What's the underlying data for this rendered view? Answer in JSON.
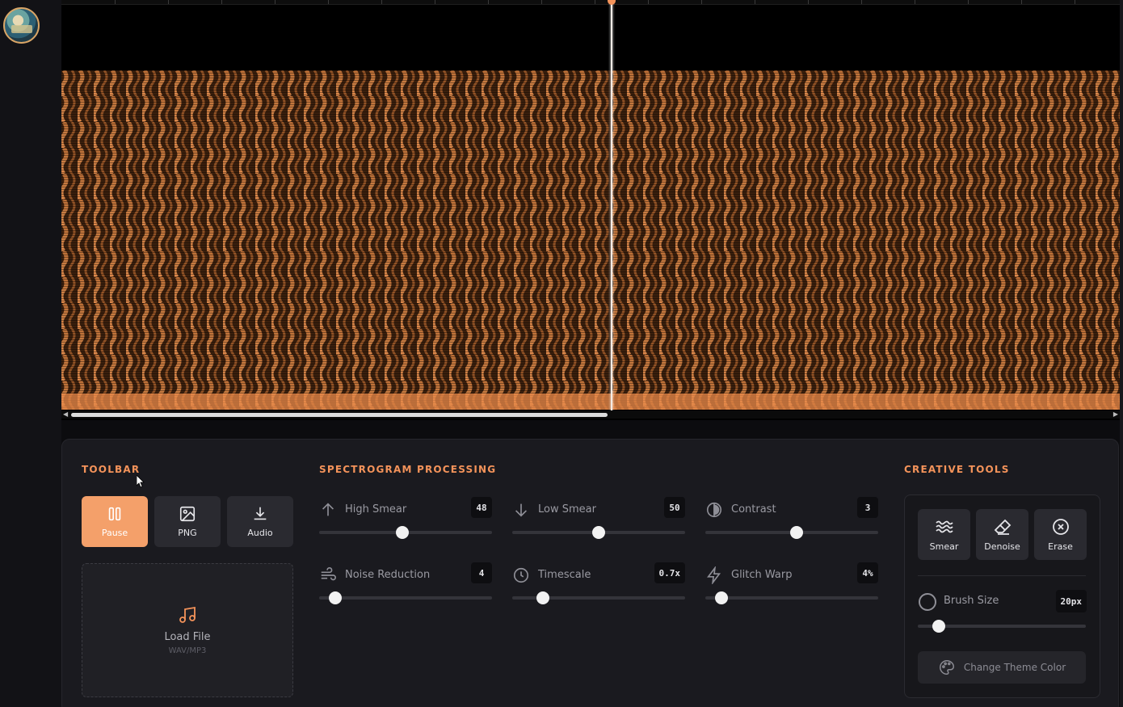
{
  "colors": {
    "accent": "#f4935a",
    "accent_button": "#f4a06a",
    "background": "#0c0c0f",
    "panel": "#1a1a1f"
  },
  "spectrogram": {
    "playhead_position_fraction": 0.52,
    "scroll_visible_fraction": 0.51
  },
  "toolbar": {
    "title": "TOOLBAR",
    "buttons": [
      {
        "label": "Pause",
        "icon": "pause-icon",
        "active": true
      },
      {
        "label": "PNG",
        "icon": "image-icon",
        "active": false
      },
      {
        "label": "Audio",
        "icon": "download-icon",
        "active": false
      }
    ],
    "load": {
      "label": "Load File",
      "sublabel": "WAV/MP3",
      "icon": "music-note-icon"
    }
  },
  "processing": {
    "title": "SPECTROGRAM PROCESSING",
    "controls": [
      {
        "label": "High Smear",
        "value": "48",
        "icon": "arrow-up-icon",
        "fraction": 0.48
      },
      {
        "label": "Low Smear",
        "value": "50",
        "icon": "arrow-down-icon",
        "fraction": 0.5
      },
      {
        "label": "Contrast",
        "value": "3",
        "icon": "contrast-icon",
        "fraction": 0.53
      },
      {
        "label": "Noise Reduction",
        "value": "4",
        "icon": "wind-icon",
        "fraction": 0.07
      },
      {
        "label": "Timescale",
        "value": "0.7x",
        "icon": "clock-icon",
        "fraction": 0.16
      },
      {
        "label": "Glitch Warp",
        "value": "4%",
        "icon": "lightning-icon",
        "fraction": 0.07
      }
    ]
  },
  "creative": {
    "title": "CREATIVE TOOLS",
    "tools": [
      {
        "label": "Smear",
        "icon": "waves-icon"
      },
      {
        "label": "Denoise",
        "icon": "eraser-icon"
      },
      {
        "label": "Erase",
        "icon": "close-circle-icon"
      }
    ],
    "brush": {
      "label": "Brush Size",
      "value": "20px",
      "fraction": 0.1
    },
    "theme_button": "Change Theme Color"
  }
}
